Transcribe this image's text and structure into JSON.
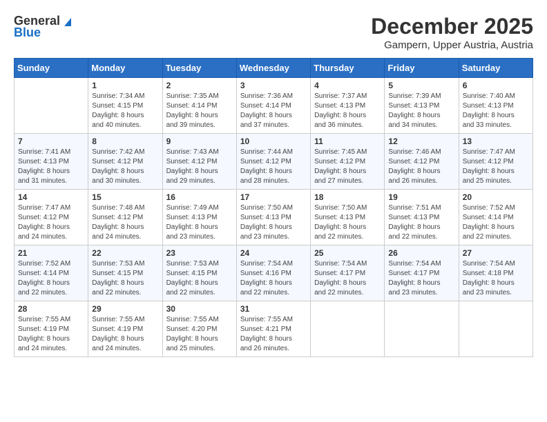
{
  "header": {
    "logo_general": "General",
    "logo_blue": "Blue",
    "month": "December 2025",
    "location": "Gampern, Upper Austria, Austria"
  },
  "days_of_week": [
    "Sunday",
    "Monday",
    "Tuesday",
    "Wednesday",
    "Thursday",
    "Friday",
    "Saturday"
  ],
  "weeks": [
    [
      {
        "day": "",
        "info": ""
      },
      {
        "day": "1",
        "info": "Sunrise: 7:34 AM\nSunset: 4:15 PM\nDaylight: 8 hours\nand 40 minutes."
      },
      {
        "day": "2",
        "info": "Sunrise: 7:35 AM\nSunset: 4:14 PM\nDaylight: 8 hours\nand 39 minutes."
      },
      {
        "day": "3",
        "info": "Sunrise: 7:36 AM\nSunset: 4:14 PM\nDaylight: 8 hours\nand 37 minutes."
      },
      {
        "day": "4",
        "info": "Sunrise: 7:37 AM\nSunset: 4:13 PM\nDaylight: 8 hours\nand 36 minutes."
      },
      {
        "day": "5",
        "info": "Sunrise: 7:39 AM\nSunset: 4:13 PM\nDaylight: 8 hours\nand 34 minutes."
      },
      {
        "day": "6",
        "info": "Sunrise: 7:40 AM\nSunset: 4:13 PM\nDaylight: 8 hours\nand 33 minutes."
      }
    ],
    [
      {
        "day": "7",
        "info": "Sunrise: 7:41 AM\nSunset: 4:13 PM\nDaylight: 8 hours\nand 31 minutes."
      },
      {
        "day": "8",
        "info": "Sunrise: 7:42 AM\nSunset: 4:12 PM\nDaylight: 8 hours\nand 30 minutes."
      },
      {
        "day": "9",
        "info": "Sunrise: 7:43 AM\nSunset: 4:12 PM\nDaylight: 8 hours\nand 29 minutes."
      },
      {
        "day": "10",
        "info": "Sunrise: 7:44 AM\nSunset: 4:12 PM\nDaylight: 8 hours\nand 28 minutes."
      },
      {
        "day": "11",
        "info": "Sunrise: 7:45 AM\nSunset: 4:12 PM\nDaylight: 8 hours\nand 27 minutes."
      },
      {
        "day": "12",
        "info": "Sunrise: 7:46 AM\nSunset: 4:12 PM\nDaylight: 8 hours\nand 26 minutes."
      },
      {
        "day": "13",
        "info": "Sunrise: 7:47 AM\nSunset: 4:12 PM\nDaylight: 8 hours\nand 25 minutes."
      }
    ],
    [
      {
        "day": "14",
        "info": "Sunrise: 7:47 AM\nSunset: 4:12 PM\nDaylight: 8 hours\nand 24 minutes."
      },
      {
        "day": "15",
        "info": "Sunrise: 7:48 AM\nSunset: 4:12 PM\nDaylight: 8 hours\nand 24 minutes."
      },
      {
        "day": "16",
        "info": "Sunrise: 7:49 AM\nSunset: 4:13 PM\nDaylight: 8 hours\nand 23 minutes."
      },
      {
        "day": "17",
        "info": "Sunrise: 7:50 AM\nSunset: 4:13 PM\nDaylight: 8 hours\nand 23 minutes."
      },
      {
        "day": "18",
        "info": "Sunrise: 7:50 AM\nSunset: 4:13 PM\nDaylight: 8 hours\nand 22 minutes."
      },
      {
        "day": "19",
        "info": "Sunrise: 7:51 AM\nSunset: 4:13 PM\nDaylight: 8 hours\nand 22 minutes."
      },
      {
        "day": "20",
        "info": "Sunrise: 7:52 AM\nSunset: 4:14 PM\nDaylight: 8 hours\nand 22 minutes."
      }
    ],
    [
      {
        "day": "21",
        "info": "Sunrise: 7:52 AM\nSunset: 4:14 PM\nDaylight: 8 hours\nand 22 minutes."
      },
      {
        "day": "22",
        "info": "Sunrise: 7:53 AM\nSunset: 4:15 PM\nDaylight: 8 hours\nand 22 minutes."
      },
      {
        "day": "23",
        "info": "Sunrise: 7:53 AM\nSunset: 4:15 PM\nDaylight: 8 hours\nand 22 minutes."
      },
      {
        "day": "24",
        "info": "Sunrise: 7:54 AM\nSunset: 4:16 PM\nDaylight: 8 hours\nand 22 minutes."
      },
      {
        "day": "25",
        "info": "Sunrise: 7:54 AM\nSunset: 4:17 PM\nDaylight: 8 hours\nand 22 minutes."
      },
      {
        "day": "26",
        "info": "Sunrise: 7:54 AM\nSunset: 4:17 PM\nDaylight: 8 hours\nand 23 minutes."
      },
      {
        "day": "27",
        "info": "Sunrise: 7:54 AM\nSunset: 4:18 PM\nDaylight: 8 hours\nand 23 minutes."
      }
    ],
    [
      {
        "day": "28",
        "info": "Sunrise: 7:55 AM\nSunset: 4:19 PM\nDaylight: 8 hours\nand 24 minutes."
      },
      {
        "day": "29",
        "info": "Sunrise: 7:55 AM\nSunset: 4:19 PM\nDaylight: 8 hours\nand 24 minutes."
      },
      {
        "day": "30",
        "info": "Sunrise: 7:55 AM\nSunset: 4:20 PM\nDaylight: 8 hours\nand 25 minutes."
      },
      {
        "day": "31",
        "info": "Sunrise: 7:55 AM\nSunset: 4:21 PM\nDaylight: 8 hours\nand 26 minutes."
      },
      {
        "day": "",
        "info": ""
      },
      {
        "day": "",
        "info": ""
      },
      {
        "day": "",
        "info": ""
      }
    ]
  ]
}
